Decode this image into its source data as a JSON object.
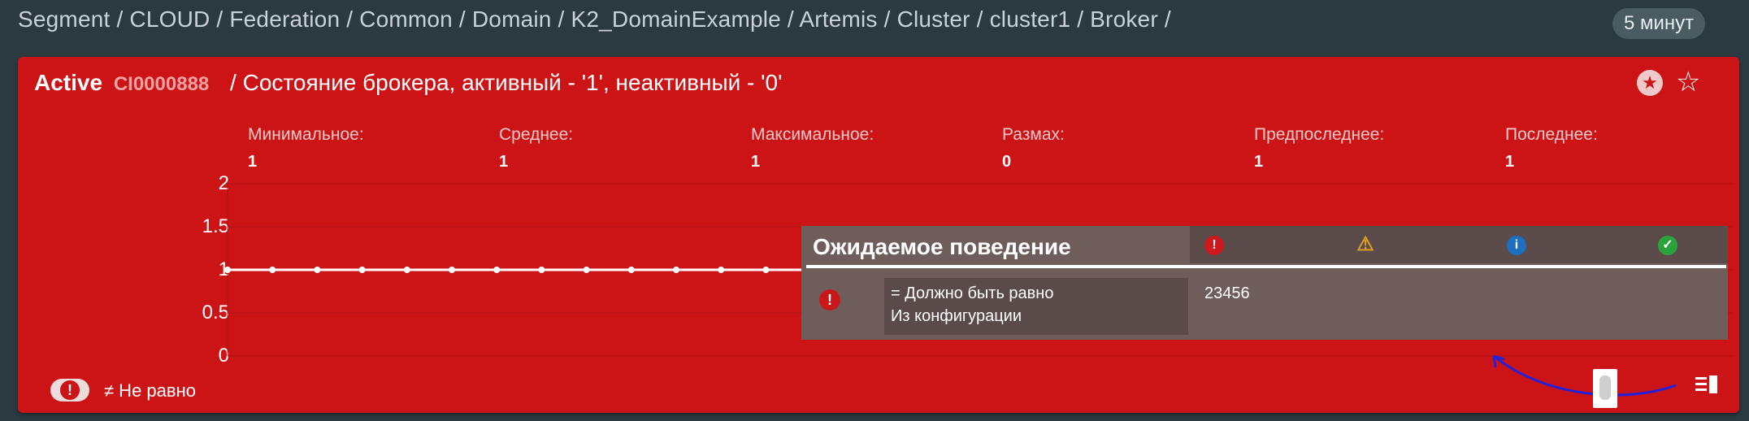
{
  "breadcrumb": "Segment / CLOUD / Federation / Common / Domain / K2_DomainExample / Artemis / Cluster / cluster1 / Broker /",
  "period": "5 минут",
  "panel": {
    "status": "Active",
    "ci": "CI0000888",
    "title": "/ Состояние брокера, активный - '1', неактивный - '0'",
    "color": "#cc1417"
  },
  "stats": [
    {
      "label": "Минимальное:",
      "value": "1"
    },
    {
      "label": "Среднее:",
      "value": "1"
    },
    {
      "label": "Максимальное:",
      "value": "1"
    },
    {
      "label": "Размах:",
      "value": "0"
    },
    {
      "label": "Предпоследнее:",
      "value": "1"
    },
    {
      "label": "Последнее:",
      "value": "1"
    }
  ],
  "chart_data": {
    "type": "line",
    "yticks": [
      "2",
      "1.5",
      "1",
      "0.5",
      "0"
    ],
    "ylim": [
      0,
      2
    ],
    "grid": true,
    "series": [
      {
        "values": [
          1,
          1,
          1,
          1,
          1,
          1,
          1,
          1,
          1,
          1,
          1,
          1,
          1,
          1,
          1,
          1,
          1,
          1,
          1,
          1,
          1,
          1,
          1,
          1,
          1,
          1,
          1,
          1,
          1,
          1,
          1,
          1,
          1,
          1
        ]
      }
    ]
  },
  "popup": {
    "title": "Ожидаемое поведение",
    "header_icons": [
      "error-icon",
      "warning-icon",
      "info-icon",
      "ok-icon"
    ],
    "condition_line1": "= Должно быть равно",
    "condition_line2": "Из конфигурации",
    "value": "23456"
  },
  "footer": {
    "neq_label": "≠ Не равно"
  }
}
